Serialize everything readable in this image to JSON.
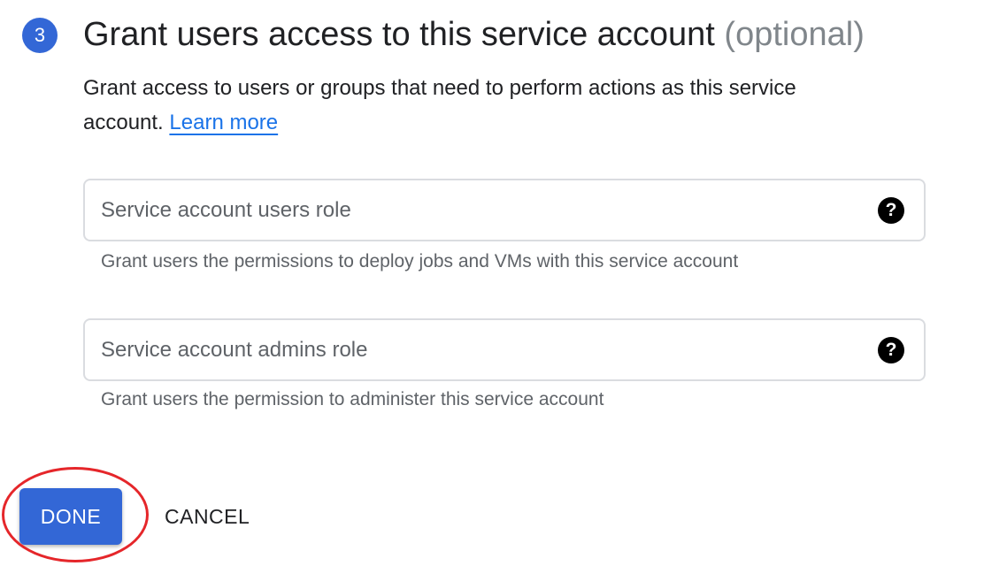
{
  "step": {
    "number": "3",
    "title": "Grant users access to this service account",
    "title_suffix": "(optional)",
    "description": "Grant access to users or groups that need to perform actions as this service account.",
    "learn_more": "Learn more"
  },
  "fields": {
    "users_role": {
      "placeholder": "Service account users role",
      "hint": "Grant users the permissions to deploy jobs and VMs with this service account",
      "icon": "help-circle-icon"
    },
    "admins_role": {
      "placeholder": "Service account admins role",
      "hint": "Grant users the permission to administer this service account",
      "icon": "help-circle-icon"
    }
  },
  "actions": {
    "done_label": "DONE",
    "cancel_label": "CANCEL"
  },
  "colors": {
    "accent": "#3367d6",
    "link": "#1a73e8",
    "annotation": "#e5262a"
  }
}
